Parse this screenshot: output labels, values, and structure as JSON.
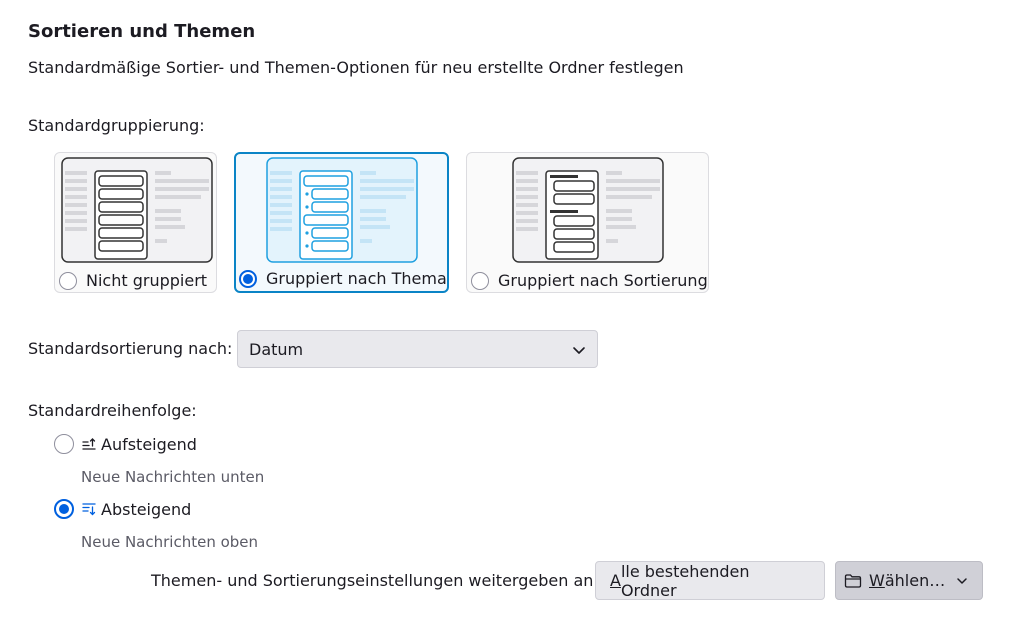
{
  "section": {
    "title": "Sortieren und Themen",
    "description": "Standardmäßige Sortier- und Themen-Optionen für neu erstellte Ordner festlegen"
  },
  "grouping": {
    "label": "Standardgruppierung:",
    "options": [
      {
        "label": "Nicht gruppiert",
        "selected": false
      },
      {
        "label": "Gruppiert nach Thema",
        "selected": true
      },
      {
        "label": "Gruppiert nach Sortierung",
        "selected": false
      }
    ]
  },
  "sort": {
    "label": "Standardsortierung nach:",
    "value": "Datum"
  },
  "order": {
    "label": "Standardreihenfolge:",
    "ascending": {
      "label": "Aufsteigend",
      "hint": "Neue Nachrichten unten",
      "selected": false
    },
    "descending": {
      "label": "Absteigend",
      "hint": "Neue Nachrichten oben",
      "selected": true
    }
  },
  "apply": {
    "label": "Themen- und Sortierungseinstellungen weitergeben an:",
    "all_folders": {
      "accesskey": "A",
      "rest": "lle bestehenden Ordner"
    },
    "choose": {
      "accesskey": "W",
      "rest": "ählen…"
    }
  },
  "colors": {
    "accent": "#0060df",
    "selected_border": "#0a84c6"
  }
}
